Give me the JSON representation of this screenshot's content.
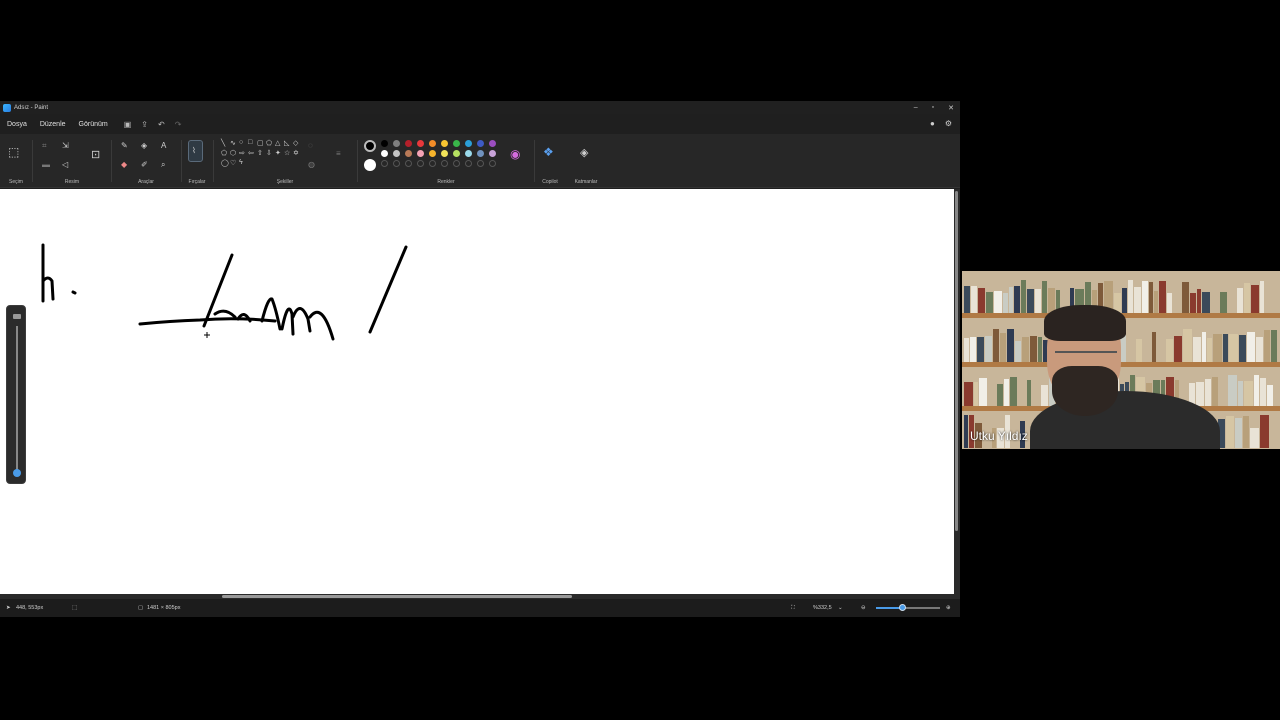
{
  "window": {
    "title": "Adsız - Paint",
    "controls": [
      "–",
      "▫",
      "✕"
    ]
  },
  "menu": {
    "items": [
      "Dosya",
      "Düzenle",
      "Görünüm"
    ],
    "quick_actions": [
      "save-icon",
      "share-icon",
      "undo-icon",
      "redo-icon"
    ]
  },
  "ribbon": {
    "groups": {
      "selection": "Seçim",
      "image": "Resim",
      "tools": "Araçlar",
      "brushes": "Fırçalar",
      "shapes": "Şekiller",
      "colors": "Renkler",
      "copilot": "Copilot",
      "layers": "Katmanlar"
    },
    "colors": {
      "primary": "#000000",
      "secondary": "#ffffff",
      "row1": [
        "#000000",
        "#7f7f7f",
        "#b3202a",
        "#e8383b",
        "#f28c28",
        "#f7c431",
        "#39b54a",
        "#2b9fd8",
        "#3d5ac4",
        "#9b4ec0"
      ],
      "row2": [
        "#ffffff",
        "#c3c3c3",
        "#b97a57",
        "#f4a3b5",
        "#f7b42c",
        "#f2e35a",
        "#b5e061",
        "#99d9ea",
        "#7092be",
        "#c8a3d8"
      ]
    }
  },
  "status": {
    "cursor": "448, 553px",
    "canvas_size": "1481 × 805px",
    "zoom": "%332,5",
    "zoom_level": 0.42
  },
  "participant": {
    "name": "Utku Yıldız"
  }
}
